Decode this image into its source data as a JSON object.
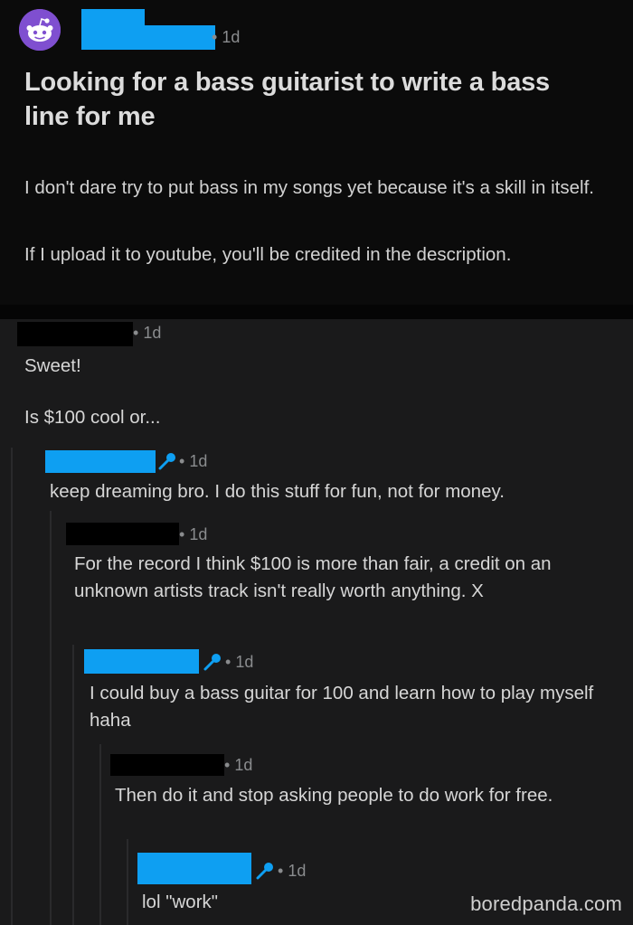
{
  "post": {
    "age": "1d",
    "title": "Looking for a bass guitarist to write a bass line for me",
    "body": [
      "I don't dare try to put bass in my songs yet because it's a skill in itself.",
      "If I upload it to youtube, you'll be credited in the description."
    ]
  },
  "comments": [
    {
      "age": "1d",
      "lines": [
        "Sweet!",
        "Is $100 cool or..."
      ]
    },
    {
      "age": "1d",
      "text": "keep dreaming bro. I do this stuff for fun, not for money."
    },
    {
      "age": "1d",
      "text": "For the record I think $100 is more than fair, a credit on an unknown artists track isn't really worth anything. X"
    },
    {
      "age": "1d",
      "text": "I could buy a bass guitar for 100 and learn how to play myself haha"
    },
    {
      "age": "1d",
      "text": "Then do it and stop asking people to do work for free."
    },
    {
      "age": "1d",
      "text": "lol \"work\""
    }
  ],
  "watermark": "boredpanda.com",
  "colors": {
    "redaction_blue": "#0e9ff2",
    "redaction_black": "#000000",
    "op_mic_icon": "#0e9ff2",
    "avatar_purple": "#7f4fd0"
  }
}
